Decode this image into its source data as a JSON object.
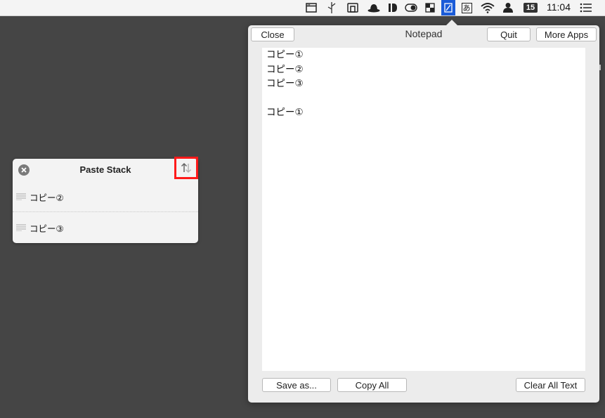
{
  "menubar": {
    "date_badge": "15",
    "clock": "11:04",
    "icons": [
      "window-icon",
      "scissors-icon",
      "copy-stack-icon",
      "hat-icon",
      "id-icon",
      "toggle-icon",
      "grid-icon",
      "notepad-app-icon",
      "hiragana-input-icon",
      "wifi-icon",
      "user-icon",
      "calendar-badge",
      "list-icon"
    ],
    "hiragana_glyph": "あ"
  },
  "notepad": {
    "title": "Notepad",
    "close_label": "Close",
    "quit_label": "Quit",
    "more_apps_label": "More Apps",
    "lines": [
      "コピー①",
      "コピー②",
      "コピー③",
      "",
      "コピー①"
    ],
    "save_as_label": "Save as...",
    "copy_all_label": "Copy All",
    "clear_all_label": "Clear All Text"
  },
  "paste_stack": {
    "title": "Paste Stack",
    "items": [
      {
        "label": "コピー②"
      },
      {
        "label": "コピー③"
      }
    ]
  }
}
